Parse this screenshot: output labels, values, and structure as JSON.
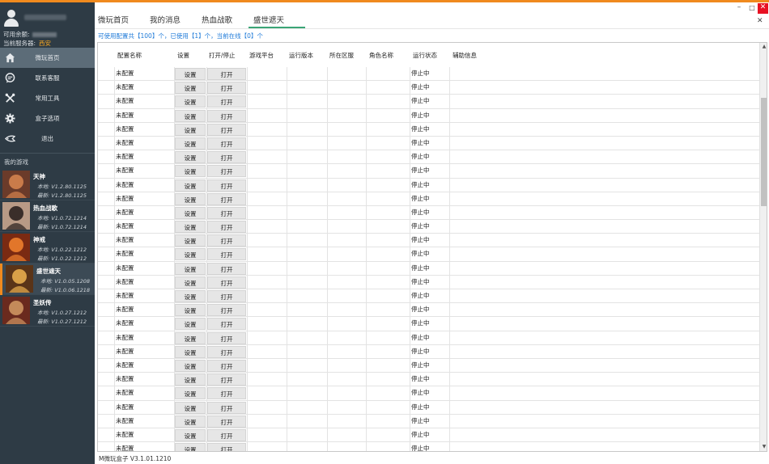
{
  "sidebar": {
    "balance_label": "可用余额:",
    "server_label": "当前服务器:",
    "server_value": "西安",
    "menu": [
      {
        "label": "微玩首页",
        "icon": "home-icon"
      },
      {
        "label": "联系客服",
        "icon": "chat-icon"
      },
      {
        "label": "常用工具",
        "icon": "tools-icon"
      },
      {
        "label": "盒子选项",
        "icon": "gear-icon"
      },
      {
        "label": "退出",
        "icon": "exit-icon"
      }
    ],
    "my_games_title": "我的游戏",
    "games": [
      {
        "name": "天神",
        "local": "本地: V1.2.80.1125",
        "latest": "最新: V1.2.80.1125",
        "color1": "#c97b4a",
        "color2": "#6b3b2a"
      },
      {
        "name": "热血战歌",
        "local": "本地: V1.0.72.1214",
        "latest": "最新: V1.0.72.1214",
        "color1": "#3a2e2a",
        "color2": "#b89a86"
      },
      {
        "name": "神戒",
        "local": "本地: V1.0.22.1212",
        "latest": "最新: V1.0.22.1212",
        "color1": "#e2762a",
        "color2": "#7a2a12"
      },
      {
        "name": "盛世遮天",
        "local": "本地: V1.0.05.1208",
        "latest": "最新: V1.0.06.1218",
        "color1": "#d8a048",
        "color2": "#5a3418"
      },
      {
        "name": "圣妖传",
        "local": "本地: V1.0.27.1212",
        "latest": "最新: V1.0.27.1212",
        "color1": "#c48a5a",
        "color2": "#6a2a1e"
      }
    ]
  },
  "tabs": [
    "微玩首页",
    "我的消息",
    "热血战歌",
    "盛世遮天"
  ],
  "window": {
    "min": "–",
    "max": "□",
    "close": "✕",
    "tab_close": "✕"
  },
  "info": "可使用配置共【100】个，已使用【1】个，当前在线【0】个",
  "table": {
    "headers": [
      "配置名称",
      "设置",
      "打开/停止",
      "游戏平台",
      "运行版本",
      "所在区服",
      "角色名称",
      "运行状态",
      "辅助信息"
    ],
    "row_name": "未配置",
    "row_setting": "设置",
    "row_open": "打开",
    "row_status": "停止中"
  },
  "scroll": {
    "up": "▲",
    "down": "▼"
  },
  "status_bar": "M微玩盒子 V3.1.01.1210",
  "colors": {
    "accent": "#f08a1e",
    "sidebar": "#2e3b45",
    "link": "#1e7ad8",
    "tab_underline": "#3aa576"
  }
}
